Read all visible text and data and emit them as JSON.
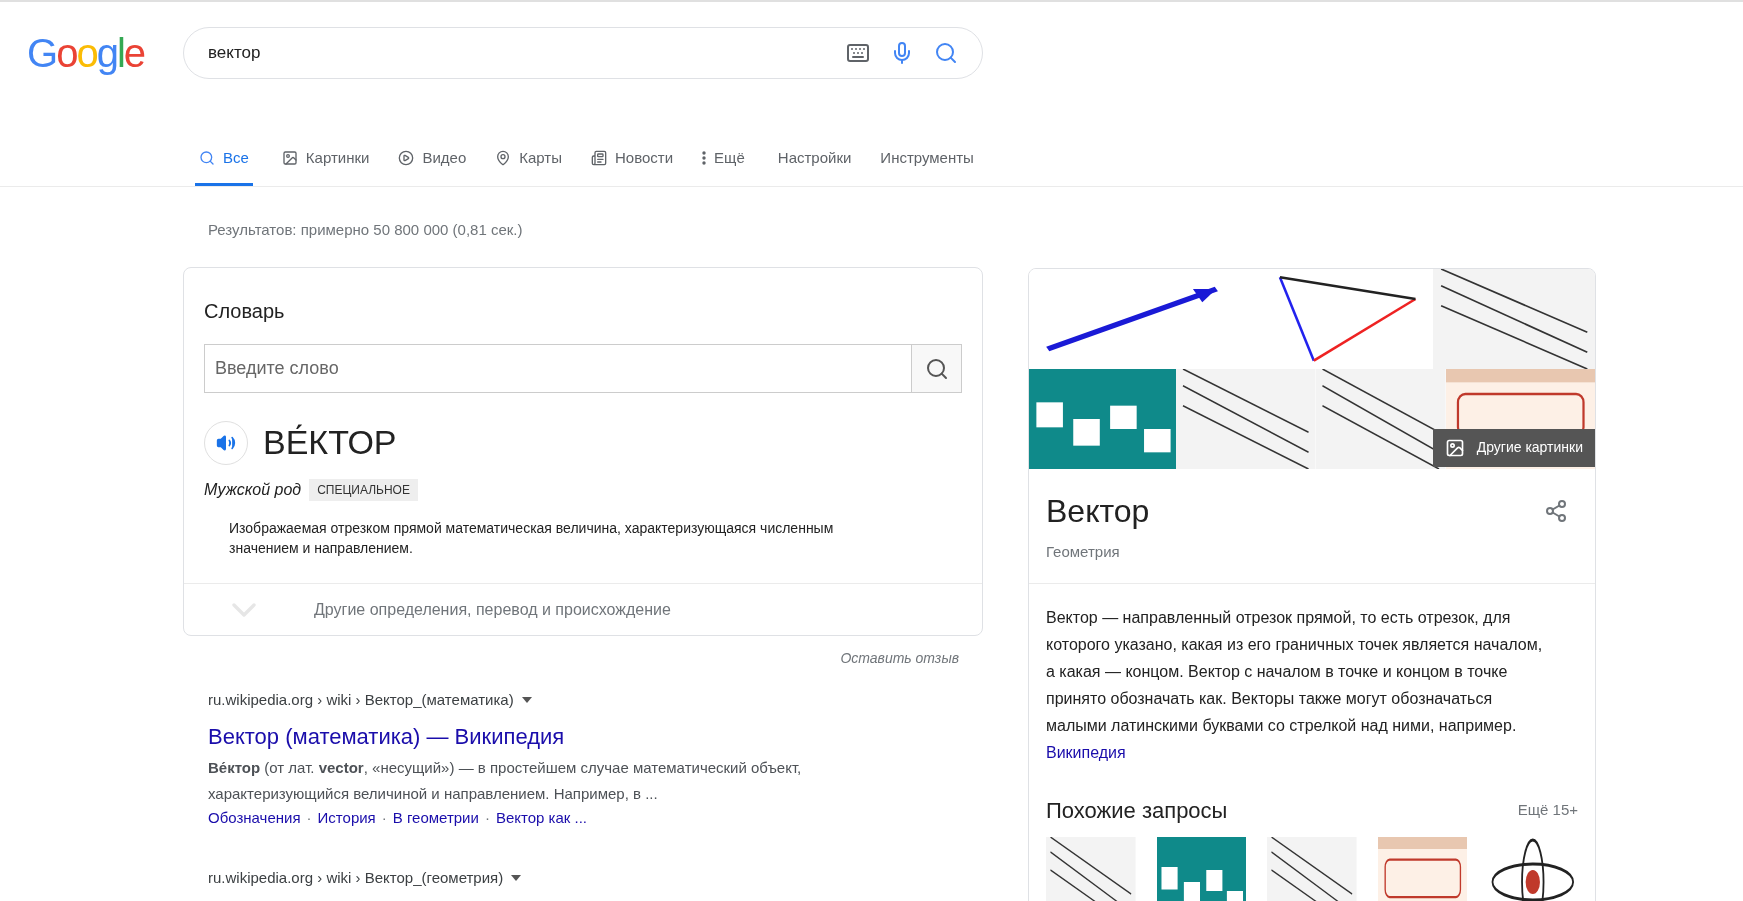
{
  "logo": "Google",
  "search": {
    "value": "вектор"
  },
  "tabs": [
    {
      "label": "Все",
      "selected": true
    },
    {
      "label": "Картинки",
      "selected": false
    },
    {
      "label": "Видео",
      "selected": false
    },
    {
      "label": "Карты",
      "selected": false
    },
    {
      "label": "Новости",
      "selected": false
    },
    {
      "label": "Ещё",
      "selected": false
    }
  ],
  "tools": [
    "Настройки",
    "Инструменты"
  ],
  "stats": "Результатов: примерно 50 800 000 (0,81 сек.)",
  "dictionary": {
    "title": "Словарь",
    "placeholder": "Введите слово",
    "word": "ВЕ́КТОР",
    "gender": "Мужской род",
    "tag": "СПЕЦИАЛЬНОЕ",
    "definition": "Изображаемая отрезком прямой математическая величина, характеризующаяся численным значением и направлением.",
    "more": "Другие определения, перевод и происхождение"
  },
  "feedback": "Оставить отзыв",
  "results": [
    {
      "url": "ru.wikipedia.org › wiki › Вектор_(математика)",
      "title": "Вектор (математика) — Википедия",
      "snippet": "**Ве́ктор** (от лат. **vector**, «несущий») — в простейшем случае математический объект, характеризующийся величиной и направлением. Например, в ...",
      "links": [
        "Обозначения",
        "История",
        "В геометрии",
        "Вектор как ..."
      ],
      "separators": [
        "·",
        "·",
        "·"
      ]
    },
    {
      "url": "ru.wikipedia.org › wiki › Вектор_(геометрия)"
    }
  ],
  "panel": {
    "more_images": "Другие картинки",
    "title": "Вектор",
    "subtitle": "Геометрия",
    "description": "Вектор — направленный отрезок прямой, то есть отрезок, для которого указано, какая из его граничных точек является началом, а какая — концом. Вектор с началом в точке и концом в точке принято обозначать как. Векторы также могут обозначаться малыми латинскими буквами со стрелкой над ними, например.",
    "source": "Википедия",
    "related_title": "Похожие запросы",
    "related_more": "Ещё 15+"
  }
}
